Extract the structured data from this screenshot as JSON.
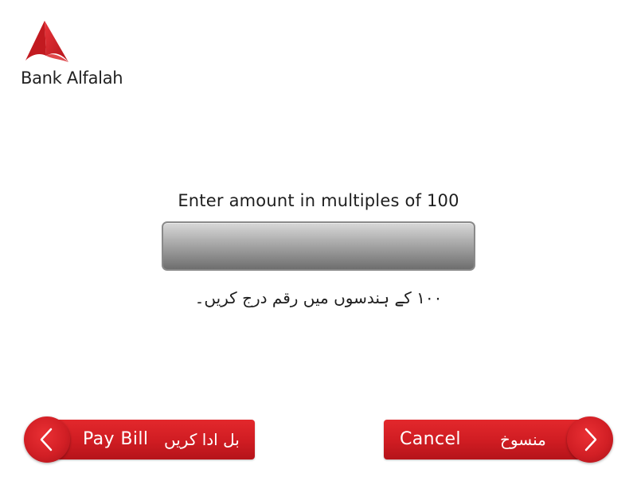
{
  "brand": {
    "name": "Bank Alfalah",
    "accent_color": "#d21f25"
  },
  "prompt": {
    "english": "Enter amount in multiples of 100",
    "urdu": "۱۰۰ کے ہندسوں میں رقم درج کریں۔"
  },
  "amount_input": {
    "value": ""
  },
  "buttons": {
    "pay_bill": {
      "label_en": "Pay Bill",
      "label_ur": "بل ادا کریں",
      "icon": "chevron-left-icon"
    },
    "cancel": {
      "label_en": "Cancel",
      "label_ur": "منسوخ",
      "icon": "chevron-right-icon"
    }
  }
}
